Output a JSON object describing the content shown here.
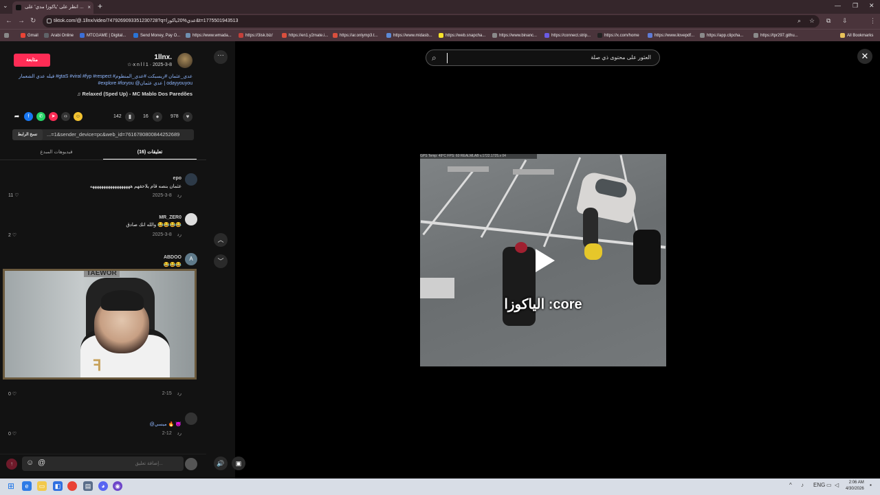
{
  "browser": {
    "tab_title": "انظر على 'ياكوزا مدي' على ...",
    "url": "tiktok.com/@.1llnx/video/7479269093351230728?q=عدي%20ياكوزا&t=1775501943513",
    "bookmarks": [
      {
        "label": "Gmail",
        "color": "#ea4335"
      },
      {
        "label": "Arabi Online",
        "color": "#5f6368"
      },
      {
        "label": "MTCGAME | Digital...",
        "color": "#3b6fd8"
      },
      {
        "label": "Send Money, Pay O...",
        "color": "#2a74d6"
      },
      {
        "label": "https://www.wmada...",
        "color": "#6f8fb0"
      },
      {
        "label": "https://3isk.biz/",
        "color": "#c4403a"
      },
      {
        "label": "https://en1.y2mate.i...",
        "color": "#d94f3d"
      },
      {
        "label": "https://ar.onlymp3.t...",
        "color": "#d94f3d"
      },
      {
        "label": "https://www.midasb...",
        "color": "#5c8ad6"
      },
      {
        "label": "https://web.snapcha...",
        "color": "#f7e32a"
      },
      {
        "label": "https://www.binanc...",
        "color": "#8a8a8a"
      },
      {
        "label": "https://connect.strip...",
        "color": "#6a5be3"
      },
      {
        "label": "https://x.com/home",
        "color": "#222222"
      },
      {
        "label": "https://www.ilovepdf...",
        "color": "#5f7bd6"
      },
      {
        "label": "https://app.clipcha...",
        "color": "#8a8a8a"
      },
      {
        "label": "https://tpr297.githu...",
        "color": "#8a8a8a"
      }
    ],
    "all_bookmarks": "All Bookmarks"
  },
  "post": {
    "follow_label": "متابعة",
    "username": "1llnx.",
    "subline": "☆·x n l l 1 · 2025-3-8",
    "description_line1": "فيله عدي الشعمار #gtaS #viral #fyp #respect #عدي_عثمان #ريسبكت #عدي_المنطوم",
    "description_line2": "#explore #foryou @عدي عثمان | odayyouyou",
    "music": "♫ Relaxed (Sped Up) - MC Mablo Dos Paredões",
    "likes": "978",
    "comments": "16",
    "saves": "142",
    "link_text": "...=1&sender_device=pc&web_id=7616780800844252689",
    "copy_label": "نسخ الرابط"
  },
  "tabs": {
    "comments": "تعليقات (16)",
    "creator_videos": "فيديوهات المبدع"
  },
  "comments": [
    {
      "name": "epo",
      "text": "عثمان بنصه قام يلاحقهم ههههههههههههههههههه",
      "date": "2025-3-8",
      "reply": "رد",
      "likes": "11"
    },
    {
      "name": "MR_ZER0",
      "text": "والله انك صادق 😂😂😂😂",
      "date": "2025-3-8",
      "reply": "رد",
      "likes": "2"
    },
    {
      "name": "ABDOO",
      "text": "😂😂😂",
      "date": "",
      "reply": "",
      "likes": ""
    },
    {
      "name": "",
      "text": "",
      "date": "2-15",
      "reply": "رد",
      "likes": "0"
    },
    {
      "name": "",
      "text": "@ميسي 🔥 😈",
      "date": "2-12",
      "reply": "رد",
      "likes": "0"
    }
  ],
  "webcam": {
    "label": "TAEWOR"
  },
  "comment_input": {
    "placeholder": "إضافة تعليق..."
  },
  "video": {
    "search_placeholder": "العثور على محتوى ذي صلة",
    "caption": "الياكوزا :core",
    "hud": "GPS Temp: 49°C  FPS: 60  REALMLAB  v.1722.1725.x 04"
  },
  "system": {
    "time": "2:06 AM",
    "date": "4/30/2026",
    "lang": "ENG"
  }
}
